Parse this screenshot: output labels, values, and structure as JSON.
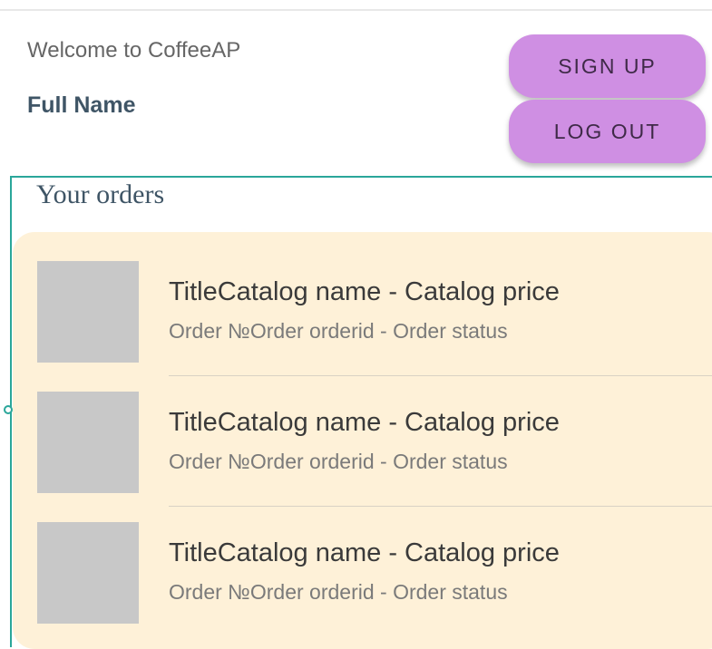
{
  "header": {
    "welcome_text": "Welcome to CoffeeAP",
    "user_name": "Full Name",
    "signup_label": "SIGN UP",
    "logout_label": "LOG OUT"
  },
  "orders": {
    "title": "Your orders",
    "items": [
      {
        "title": "TitleCatalog name - Catalog price",
        "subtitle": "Order №Order orderid - Order status"
      },
      {
        "title": "TitleCatalog name - Catalog price",
        "subtitle": "Order №Order orderid - Order status"
      },
      {
        "title": "TitleCatalog name - Catalog price",
        "subtitle": "Order №Order orderid - Order status"
      }
    ]
  },
  "colors": {
    "button_bg": "#cf8fe3",
    "card_bg": "#fef1d8",
    "thumbnail": "#c8c8c8",
    "frame_outline": "#2aa69a",
    "heading_text": "#3f5566"
  }
}
